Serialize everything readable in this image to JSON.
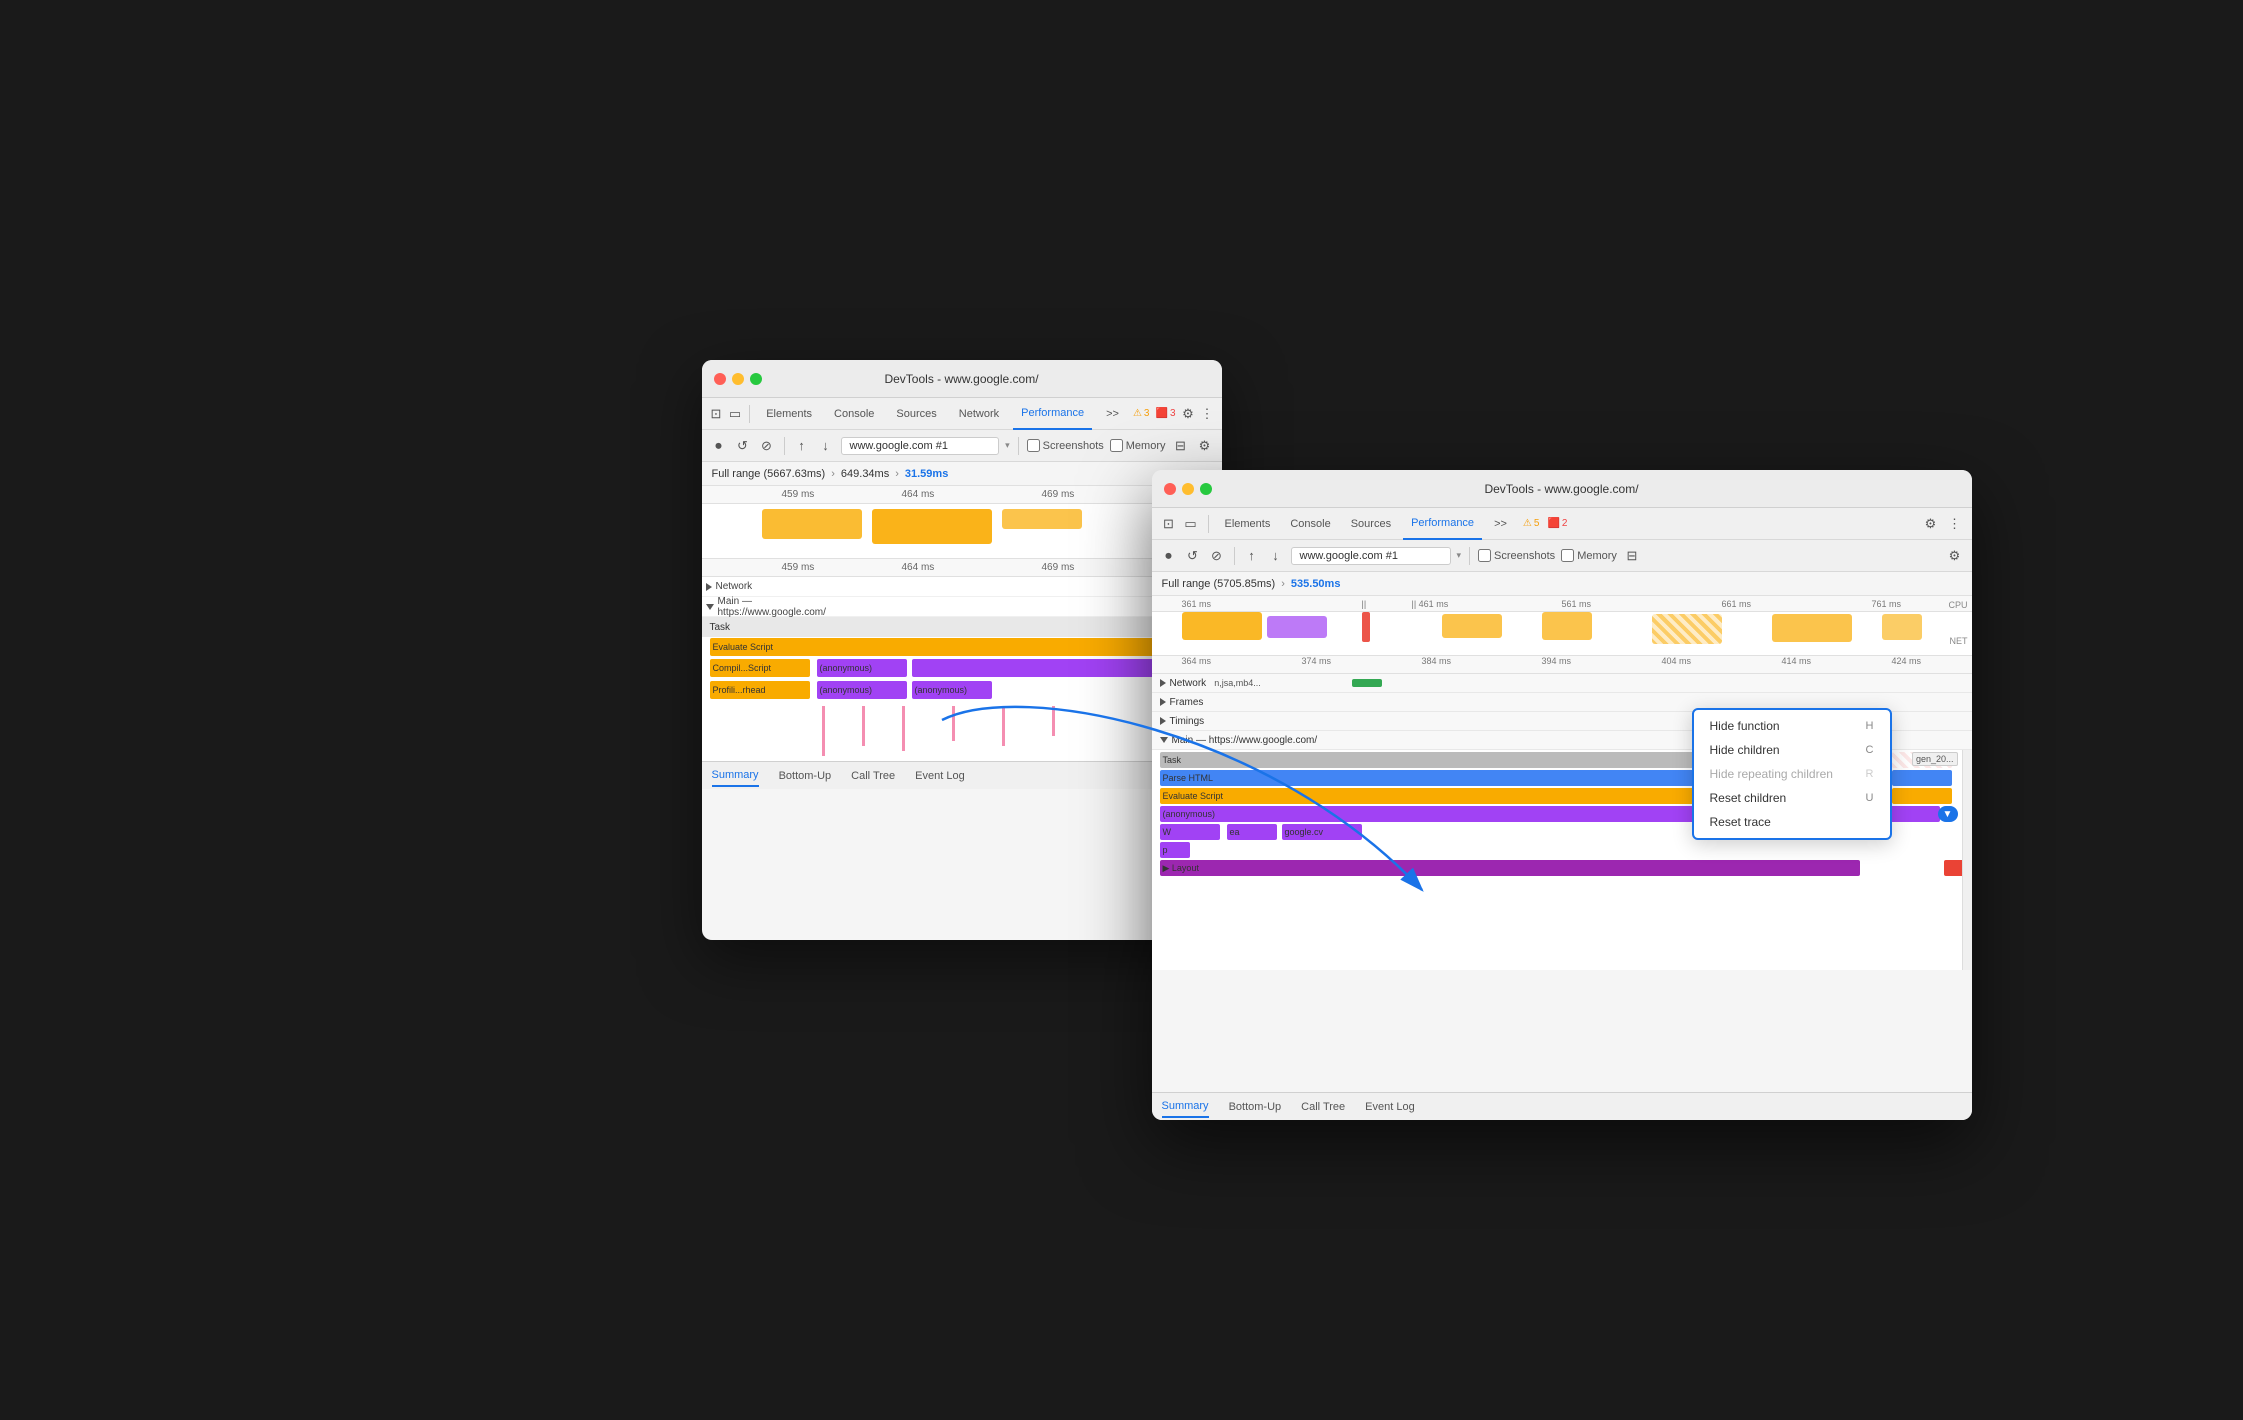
{
  "back_window": {
    "title": "DevTools - www.google.com/",
    "tabs": [
      "Elements",
      "Console",
      "Sources",
      "Network",
      "Performance"
    ],
    "active_tab": "Performance",
    "warn_count": "3",
    "error_count": "3",
    "url": "www.google.com #1",
    "checkboxes": [
      "Screenshots",
      "Memory"
    ],
    "range_text": "Full range (5667.63ms)",
    "range_sep": ">",
    "range_mid": "649.34ms",
    "range_sep2": ">",
    "range_end": "31.59ms",
    "ticks": [
      "459 ms",
      "464 ms",
      "469 ms"
    ],
    "ticks2": [
      "459 ms",
      "464 ms",
      "469 ms"
    ],
    "tracks": [
      "Network",
      "Main — https://www.google.com/"
    ],
    "task_label": "Task",
    "flame_rows": [
      {
        "label": "Evaluate Script",
        "color": "#f9ab00"
      },
      {
        "label": "Compil...Script",
        "color": "#f9ab00"
      },
      {
        "label": "Profili...rhead",
        "color": "#f9ab00"
      }
    ],
    "bottom_tabs": [
      "Summary",
      "Bottom-Up",
      "Call Tree",
      "Event Log"
    ],
    "active_bottom_tab": "Summary"
  },
  "front_window": {
    "title": "DevTools - www.google.com/",
    "tabs": [
      "Elements",
      "Console",
      "Sources",
      "Performance"
    ],
    "active_tab": "Performance",
    "more_label": ">>",
    "warn_count": "5",
    "error_count": "2",
    "url": "www.google.com #1",
    "checkboxes": [
      "Screenshots",
      "Memory"
    ],
    "range_text": "Full range (5705.85ms)",
    "range_sep": ">",
    "range_end": "535.50ms",
    "ticks_top": [
      "361 ms",
      "461 ms",
      "561 ms",
      "661 ms",
      "761 ms"
    ],
    "ticks_mid": [
      "364 ms",
      "374 ms",
      "384 ms",
      "394 ms",
      "404 ms",
      "414 ms",
      "424 ms"
    ],
    "cpu_label": "CPU",
    "net_label": "NET",
    "tracks": {
      "network": "Network",
      "frames": "Frames",
      "timings": "Timings",
      "main": "Main — https://www.google.com/"
    },
    "flame_items": [
      {
        "label": "Task",
        "color": "#bbb"
      },
      {
        "label": "Parse HTML",
        "color": "#4285f4"
      },
      {
        "label": "Evaluate Script",
        "color": "#f9ab00"
      },
      {
        "label": "(anonymous)",
        "color": "#a142f4"
      },
      {
        "label": "W",
        "color": "#a142f4"
      },
      {
        "label": "ea",
        "color": "#a142f4"
      },
      {
        "label": "google.cv",
        "color": "#a142f4"
      },
      {
        "label": "p",
        "color": "#a142f4"
      },
      {
        "label": "Layout",
        "color": "#9c27b0"
      }
    ],
    "gen_label": "gen_20...",
    "context_menu": {
      "items": [
        {
          "label": "Hide function",
          "key": "H",
          "disabled": false
        },
        {
          "label": "Hide children",
          "key": "C",
          "disabled": false
        },
        {
          "label": "Hide repeating children",
          "key": "R",
          "disabled": true
        },
        {
          "label": "Reset children",
          "key": "U",
          "disabled": false
        },
        {
          "label": "Reset trace",
          "key": "",
          "disabled": false
        }
      ]
    },
    "bottom_tabs": [
      "Summary",
      "Bottom-Up",
      "Call Tree",
      "Event Log"
    ],
    "active_bottom_tab": "Summary"
  }
}
